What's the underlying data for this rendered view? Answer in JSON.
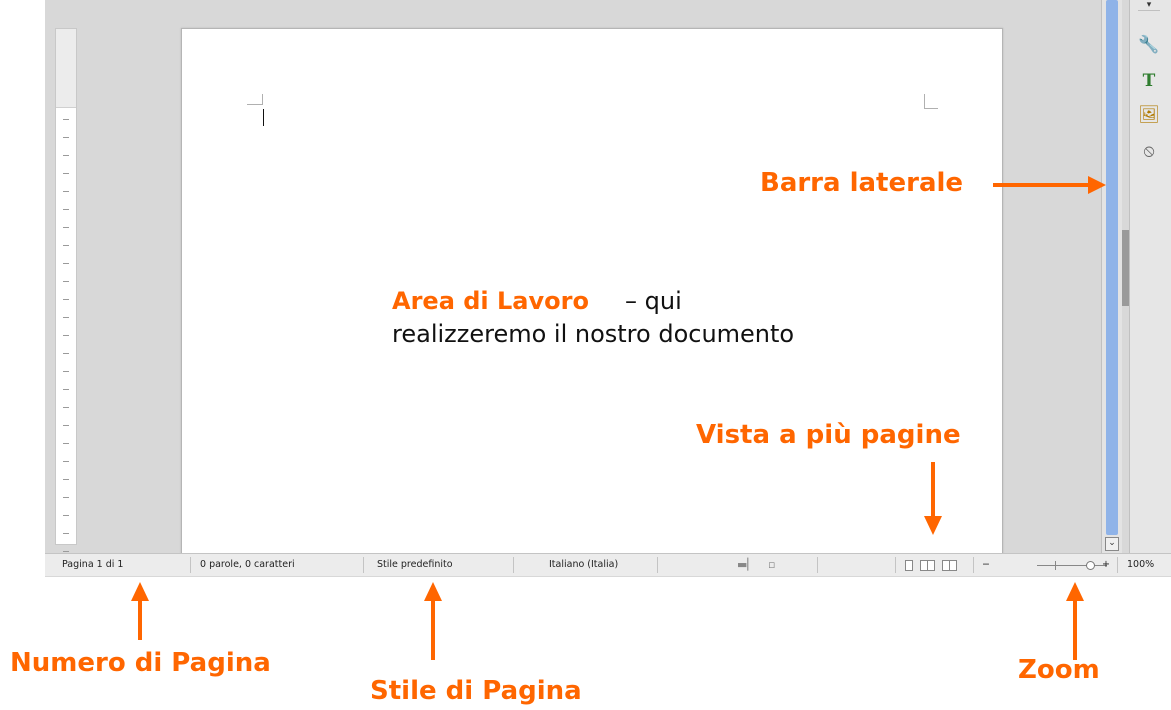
{
  "statusbar": {
    "page": "Pagina 1 di 1",
    "words": "0 parole, 0 caratteri",
    "page_style": "Stile predefinito",
    "language": "Italiano (Italia)",
    "zoom_minus": "−",
    "zoom_plus": "+",
    "zoom_value": "100%"
  },
  "sidebar": {
    "menu_glyph": "▾",
    "properties_glyph": "🔧",
    "styles_glyph": "T",
    "gallery_glyph": "🖼",
    "navigator_glyph": "⦸"
  },
  "scrollbar": {
    "down_glyph": "⌄"
  },
  "annotations": {
    "work_area_title": "Area di Lavoro",
    "work_area_line1": " – qui",
    "work_area_line2": "realizzeremo il nostro documento",
    "sidebar": "Barra laterale",
    "multi_page": "Vista a più pagine",
    "page_number": "Numero di Pagina",
    "page_style": "Stile di Pagina",
    "zoom": "Zoom"
  },
  "colors": {
    "accent": "#ff6600",
    "scroll_thumb": "#8fb3e8",
    "workspace": "#d8d8d8"
  }
}
